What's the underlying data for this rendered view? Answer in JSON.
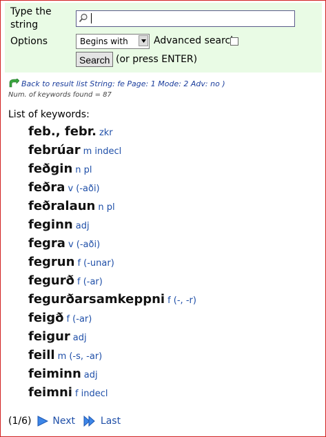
{
  "search": {
    "string_label": "Type the string",
    "options_label": "Options",
    "query_value": "",
    "mode_selected": "Begins with",
    "advanced_label": "Advanced search",
    "advanced_checked": false,
    "button_label": "Search",
    "press_hint": "(or press ENTER)"
  },
  "results": {
    "back_link": "Back to result list String: fe Page: 1 Mode: 2 Adv: no )",
    "count_text": "Num. of keywords found = 87",
    "list_title": "List of keywords:",
    "keywords": [
      {
        "word": "feb., febr.",
        "gram": "zkr"
      },
      {
        "word": "febrúar",
        "gram": "m indecl"
      },
      {
        "word": "feðgin",
        "gram": "n pl"
      },
      {
        "word": "feðra",
        "gram": "v (-aði)"
      },
      {
        "word": "feðralaun",
        "gram": "n pl"
      },
      {
        "word": "feginn",
        "gram": "adj"
      },
      {
        "word": "fegra",
        "gram": "v (-aði)"
      },
      {
        "word": "fegrun",
        "gram": "f (-unar)"
      },
      {
        "word": "fegurð",
        "gram": "f (-ar)"
      },
      {
        "word": "fegurðarsamkeppni",
        "gram": "f (-, -r)"
      },
      {
        "word": "feigð",
        "gram": "f (-ar)"
      },
      {
        "word": "feigur",
        "gram": "adj"
      },
      {
        "word": "feill",
        "gram": "m (-s, -ar)"
      },
      {
        "word": "feiminn",
        "gram": "adj"
      },
      {
        "word": "feimni",
        "gram": "f indecl"
      }
    ]
  },
  "pager": {
    "page_count": "(1/6)",
    "next_label": "Next",
    "last_label": "Last"
  },
  "colors": {
    "panel_bg": "#e9fbe5",
    "link_blue": "#1f4fa8",
    "frame_red": "#d22020"
  },
  "icons": {
    "search_field": "magnifier-icon",
    "back": "back-arrow-icon",
    "next": "play-arrow-icon",
    "last": "double-arrow-icon"
  }
}
